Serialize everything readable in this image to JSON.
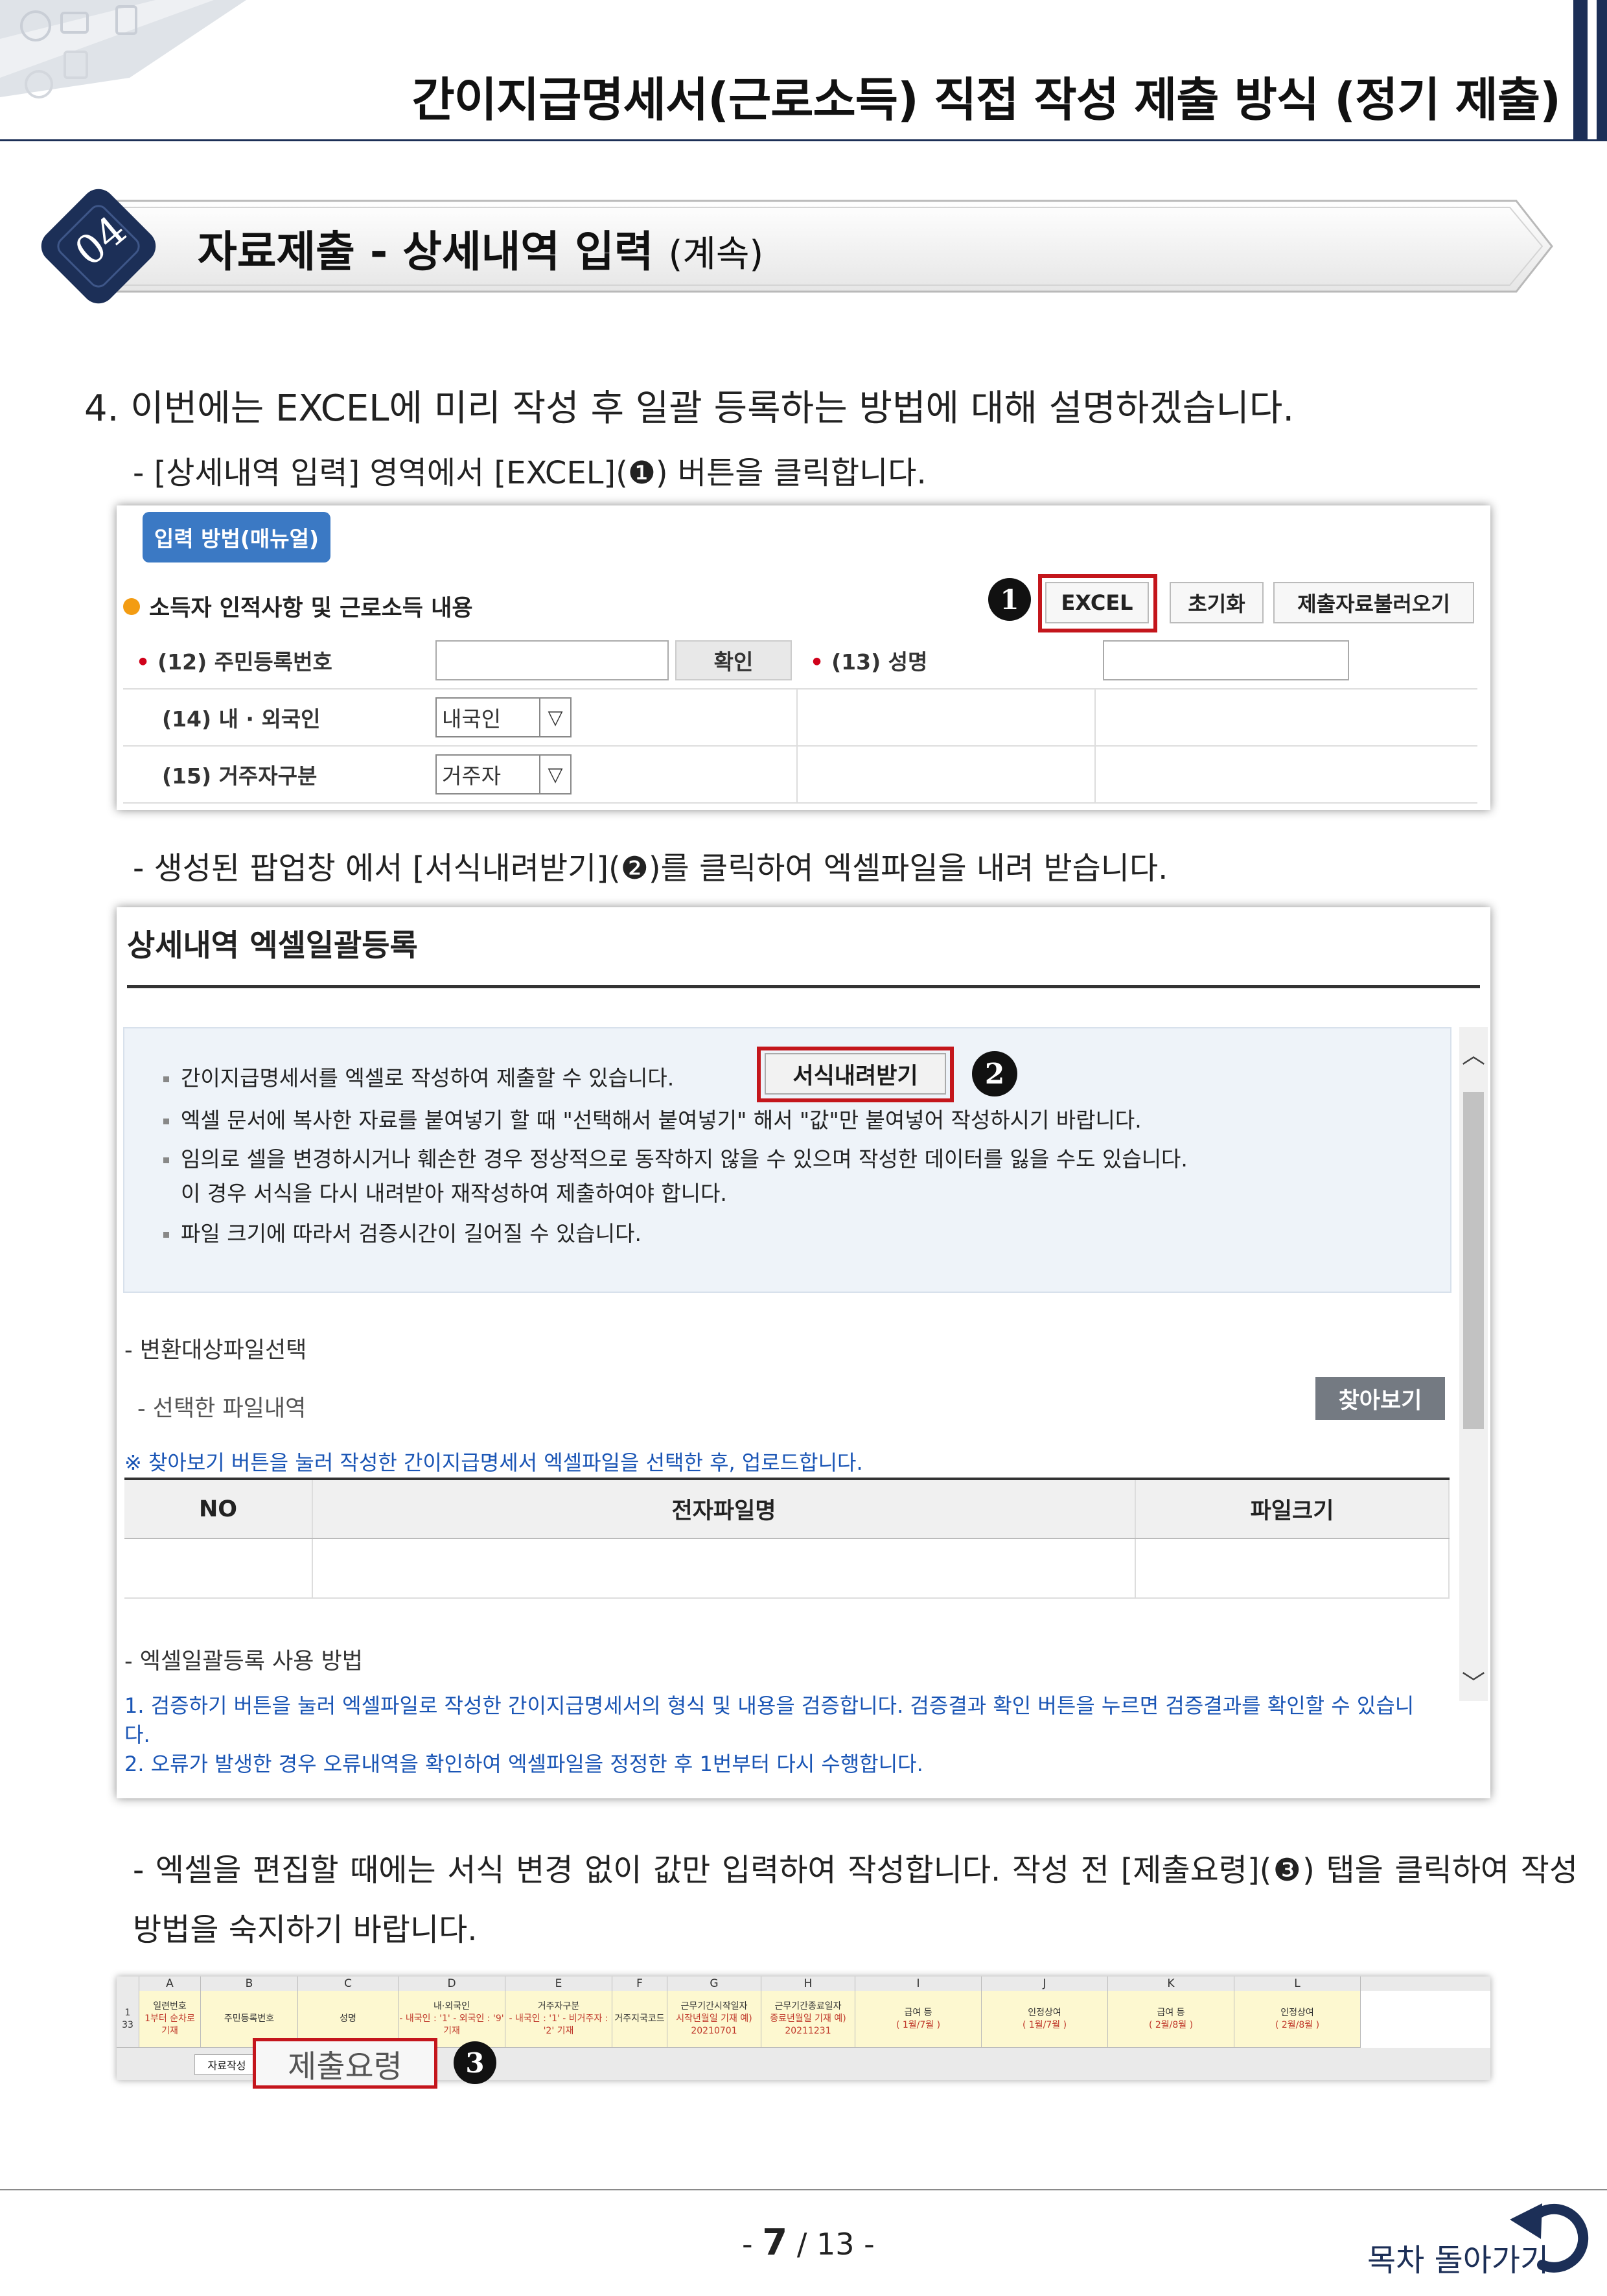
{
  "header": {
    "title": "간이지급명세서(근로소득) 직접 작성 제출 방식 (정기 제출)"
  },
  "section": {
    "number": "04",
    "title": "자료제출 - 상세내역 입력",
    "subtitle": "(계속)"
  },
  "paragraphs": {
    "p1": "4. 이번에는 EXCEL에 미리 작성 후 일괄 등록하는 방법에 대해 설명하겠습니다.",
    "p2_pre": "- [상세내역 입력] 영역에서 [EXCEL](",
    "p2_mark": "❶",
    "p2_post": ") 버튼을 클릭합니다.",
    "p3_pre": "- 생성된 팝업창 에서 [서식내려받기](",
    "p3_mark": "❷",
    "p3_post": ")를 클릭하여 엑셀파일을 내려 받습니다.",
    "p4_pre": "- 엑셀을 편집할 때에는 서식 변경 없이 값만 입력하여 작성합니다. 작성 전 [제출요령](",
    "p4_mark": "❸",
    "p4_post": ") 탭을 클릭하여 작성 방법을 숙지하기 바랍니다."
  },
  "shot1": {
    "manual_button": "입력 방법(매뉴얼)",
    "heading": "소득자 인적사항 및 근로소득 내용",
    "btn_excel": "EXCEL",
    "btn_reset": "초기화",
    "btn_load": "제출자료불러오기",
    "marker": "1",
    "row1_label": "(12) 주민등록번호",
    "row1_confirm": "확인",
    "row1_label2": "(13) 성명",
    "row2_label": "(14) 내 · 외국인",
    "row2_value": "내국인",
    "row3_label": "(15) 거주자구분",
    "row3_value": "거주자"
  },
  "shot2": {
    "title": "상세내역 엑셀일괄등록",
    "info1": "간이지급명세서를 엑셀로 작성하여 제출할 수 있습니다.",
    "btn_form": "서식내려받기",
    "marker": "2",
    "info2": "엑셀 문서에 복사한 자료를 붙여넣기 할 때 \"선택해서 붙여넣기\" 해서 \"값\"만 붙여넣어 작성하시기 바랍니다.",
    "info3": "임의로 셀을 변경하시거나 훼손한 경우 정상적으로 동작하지 않을 수 있으며 작성한 데이터를 잃을 수도 있습니다.",
    "info3b": "이 경우 서식을 다시 내려받아 재작성하여 제출하여야 합니다.",
    "info4": "파일 크기에 따라서 검증시간이 길어질 수 있습니다.",
    "select_label": "- 변환대상파일선택",
    "selected_label": "- 선택한 파일내역",
    "btn_browse": "찾아보기",
    "note": "※ 찾아보기 버튼을 눌러 작성한 간이지급명세서 엑셀파일을 선택한 후, 업로드합니다.",
    "col_no": "NO",
    "col_name": "전자파일명",
    "col_size": "파일크기",
    "how_title": "- 엑셀일괄등록 사용 방법",
    "how1": "1. 검증하기 버튼을 눌러 엑셀파일로 작성한 간이지급명세서의 형식 및 내용을 검증합니다. 검증결과 확인 버튼을 누르면 검증결과를 확인할 수 있습니다.",
    "how2": "2. 오류가 발생한 경우 오류내역을 확인하여 엑셀파일을 정정한 후 1번부터 다시 수행합니다."
  },
  "shot3": {
    "cols": [
      "A",
      "B",
      "C",
      "D",
      "E",
      "F",
      "G",
      "H",
      "I",
      "J",
      "K",
      "L"
    ],
    "headers": [
      {
        "l1": "일련번호",
        "l2": "1부터 순차로 기재"
      },
      {
        "l1": "주민등록번호",
        "l2": ""
      },
      {
        "l1": "성명",
        "l2": ""
      },
      {
        "l1": "내·외국인",
        "l2": "- 내국인 : '1'  - 외국인 : '9'  기재"
      },
      {
        "l1": "거주자구분",
        "l2": "- 내국인 : '1'  - 비거주자 : '2' 기재"
      },
      {
        "l1": "거주지국코드",
        "l2": ""
      },
      {
        "l1": "근무기간시작일자",
        "l2": "시작년월일 기재 예) 20210701"
      },
      {
        "l1": "근무기간종료일자",
        "l2": "종료년월일 기재 예) 20211231"
      },
      {
        "l1": "급여 등",
        "l2": "( 1월/7월 )"
      },
      {
        "l1": "인정상여",
        "l2": "( 1월/7월 )"
      },
      {
        "l1": "급여 등",
        "l2": "( 2월/8월 )"
      },
      {
        "l1": "인정상여",
        "l2": "( 2월/8월 )"
      }
    ],
    "row_nums": [
      "1",
      "33"
    ],
    "tab_small": "자료작성",
    "tab_big": "제출요령",
    "marker": "3"
  },
  "footer": {
    "page_current": "7",
    "page_total": "13",
    "toc_label": "목차 돌아가기"
  }
}
